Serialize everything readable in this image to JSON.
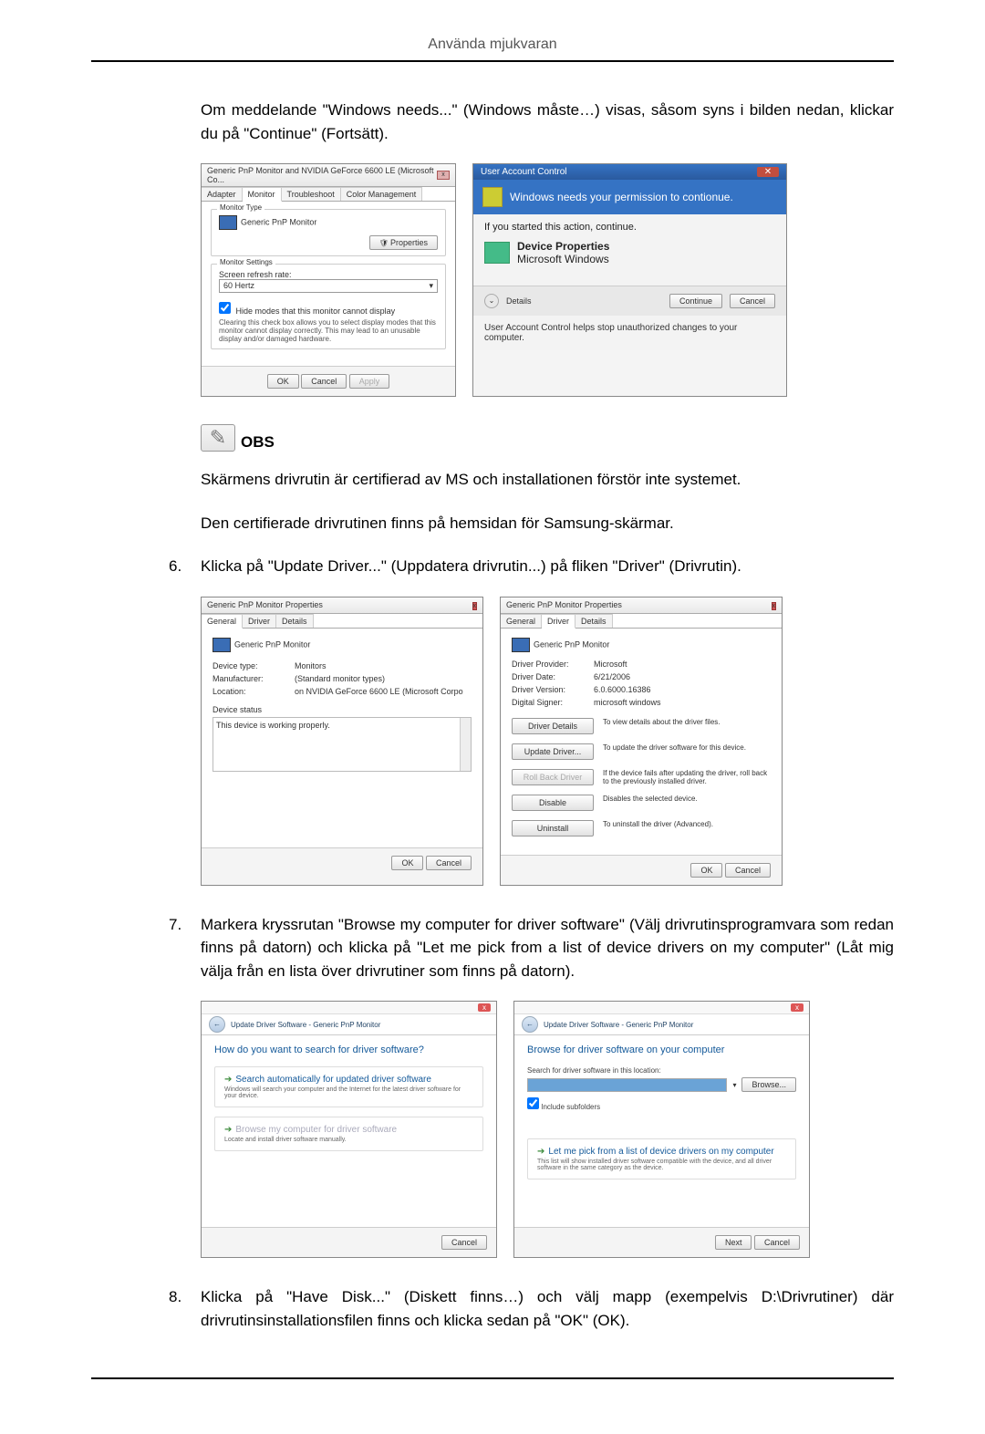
{
  "header": {
    "title": "Använda mjukvaran"
  },
  "intro": "Om meddelande \"Windows needs...\" (Windows måste…) visas, såsom syns i bilden nedan, klickar du på \"Continue\" (Fortsätt).",
  "shot1": {
    "left": {
      "title": "Generic PnP Monitor and NVIDIA GeForce 6600 LE (Microsoft Co...",
      "tabs": [
        "Adapter",
        "Monitor",
        "Troubleshoot",
        "Color Management"
      ],
      "active_tab_index": 1,
      "monitor_type_grp": "Monitor Type",
      "monitor_name": "Generic PnP Monitor",
      "properties_btn": "Properties",
      "settings_grp": "Monitor Settings",
      "refresh_label": "Screen refresh rate:",
      "refresh_value": "60 Hertz",
      "hide_modes_check": "Hide modes that this monitor cannot display",
      "hide_modes_desc": "Clearing this check box allows you to select display modes that this monitor cannot display correctly. This may lead to an unusable display and/or damaged hardware.",
      "ok": "OK",
      "cancel": "Cancel",
      "apply": "Apply"
    },
    "right": {
      "title": "User Account Control",
      "headline": "Windows needs your permission to contionue.",
      "started": "If you started this action, continue.",
      "app_name": "Device Properties",
      "app_pub": "Microsoft Windows",
      "details": "Details",
      "continue": "Continue",
      "cancel": "Cancel",
      "footer": "User Account Control helps stop unauthorized changes to your computer."
    }
  },
  "obs": {
    "label": "OBS",
    "line1": "Skärmens drivrutin är certifierad av MS och installationen förstör inte systemet.",
    "line2": "Den certifierade drivrutinen finns på hemsidan för Samsung-skärmar."
  },
  "step6": {
    "num": "6.",
    "text": "Klicka på \"Update Driver...\" (Uppdatera drivrutin...) på fliken \"Driver\" (Drivrutin)."
  },
  "shot2": {
    "left": {
      "title": "Generic PnP Monitor Properties",
      "tabs": [
        "General",
        "Driver",
        "Details"
      ],
      "active_tab_index": 0,
      "monitor_name": "Generic PnP Monitor",
      "rows": {
        "device_type_lbl": "Device type:",
        "device_type_val": "Monitors",
        "manufacturer_lbl": "Manufacturer:",
        "manufacturer_val": "(Standard monitor types)",
        "location_lbl": "Location:",
        "location_val": "on NVIDIA GeForce 6600 LE (Microsoft Corpo"
      },
      "device_status_lbl": "Device status",
      "device_status_val": "This device is working properly.",
      "ok": "OK",
      "cancel": "Cancel"
    },
    "right": {
      "title": "Generic PnP Monitor Properties",
      "tabs": [
        "General",
        "Driver",
        "Details"
      ],
      "active_tab_index": 1,
      "monitor_name": "Generic PnP Monitor",
      "info": {
        "provider_lbl": "Driver Provider:",
        "provider_val": "Microsoft",
        "date_lbl": "Driver Date:",
        "date_val": "6/21/2006",
        "version_lbl": "Driver Version:",
        "version_val": "6.0.6000.16386",
        "signer_lbl": "Digital Signer:",
        "signer_val": "microsoft windows"
      },
      "buttons": {
        "details": "Driver Details",
        "details_desc": "To view details about the driver files.",
        "update": "Update Driver...",
        "update_desc": "To update the driver software for this device.",
        "rollback": "Roll Back Driver",
        "rollback_desc": "If the device fails after updating the driver, roll back to the previously installed driver.",
        "disable": "Disable",
        "disable_desc": "Disables the selected device.",
        "uninstall": "Uninstall",
        "uninstall_desc": "To uninstall the driver (Advanced)."
      },
      "ok": "OK",
      "cancel": "Cancel"
    }
  },
  "step7": {
    "num": "7.",
    "text": "Markera kryssrutan \"Browse my computer for driver software\" (Välj drivrutinsprogramvara som redan finns på datorn) och klicka på \"Let me pick from a list of device drivers on my computer\" (Låt mig välja från en lista över drivrutiner som finns på datorn)."
  },
  "shot3": {
    "left": {
      "breadcrumb": "Update Driver Software - Generic PnP Monitor",
      "heading": "How do you want to search for driver software?",
      "opt1_title": "Search automatically for updated driver software",
      "opt1_desc": "Windows will search your computer and the Internet for the latest driver software for your device.",
      "opt2_title": "Browse my computer for driver software",
      "opt2_desc": "Locate and install driver software manually.",
      "cancel": "Cancel"
    },
    "right": {
      "breadcrumb": "Update Driver Software - Generic PnP Monitor",
      "heading": "Browse for driver software on your computer",
      "search_lbl": "Search for driver software in this location:",
      "browse": "Browse...",
      "include_sub": "Include subfolders",
      "opt_title": "Let me pick from a list of device drivers on my computer",
      "opt_desc": "This list will show installed driver software compatible with the device, and all driver software in the same category as the device.",
      "next": "Next",
      "cancel": "Cancel"
    }
  },
  "step8": {
    "num": "8.",
    "text": "Klicka på \"Have Disk...\" (Diskett finns…) och välj mapp (exempelvis D:\\Drivrutiner) där drivrutinsinstallationsfilen finns och klicka sedan på \"OK\" (OK)."
  }
}
